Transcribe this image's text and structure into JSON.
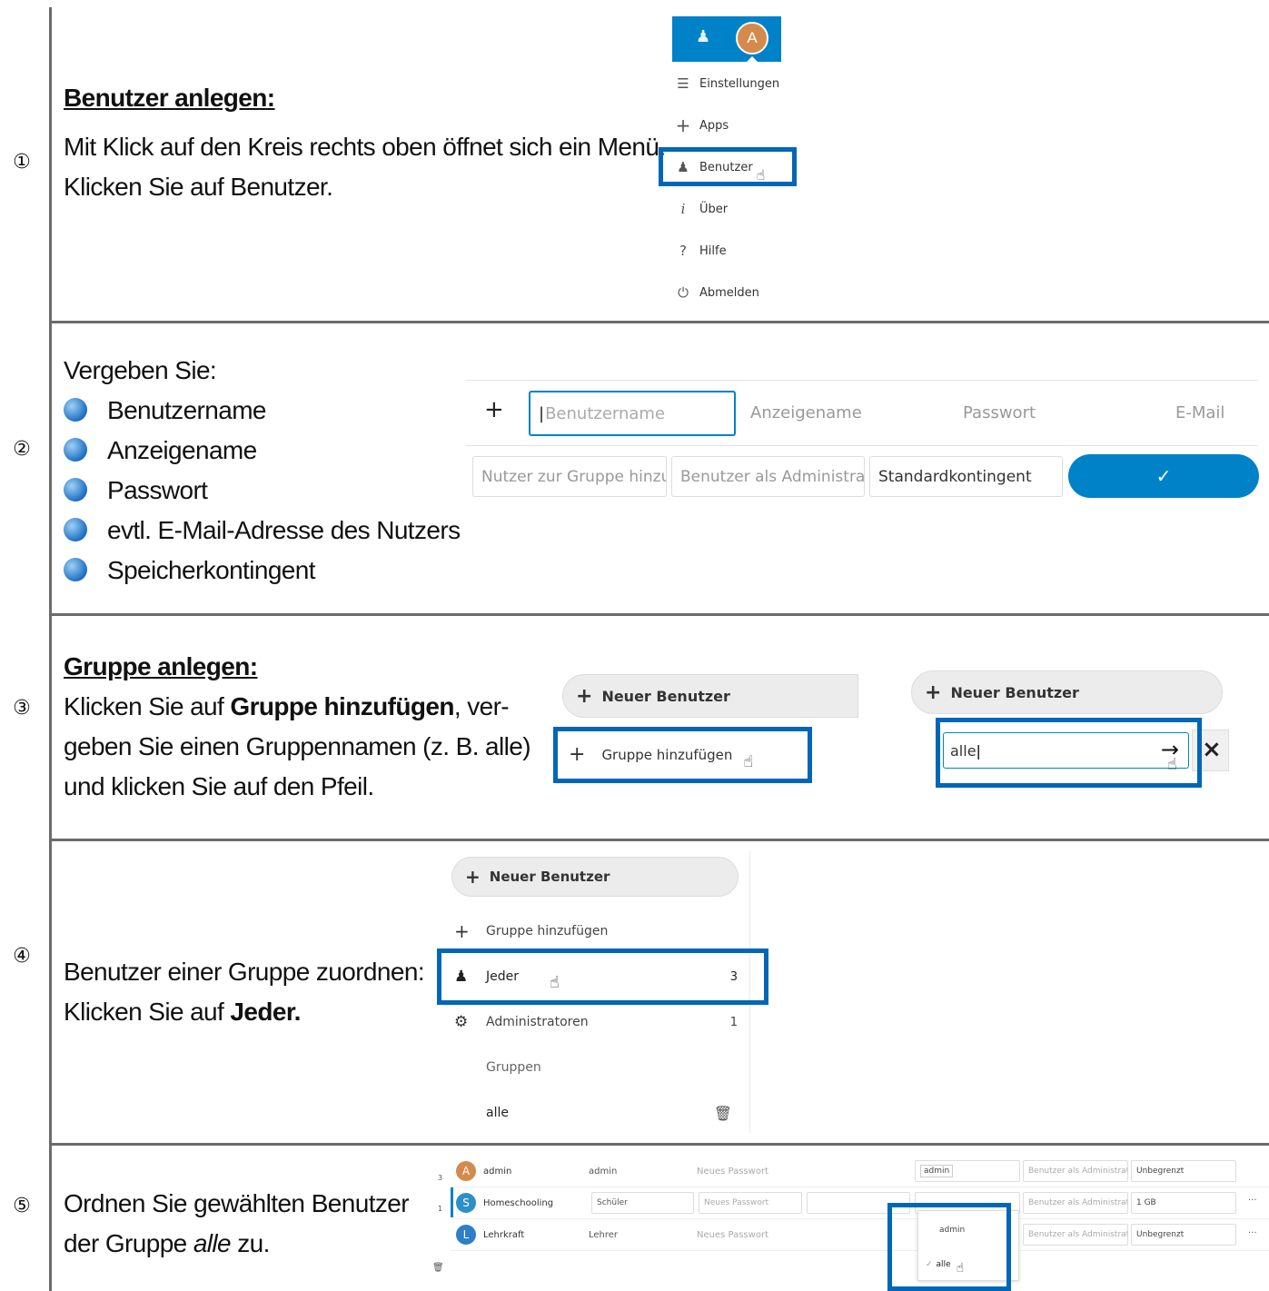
{
  "steps": [
    {
      "num": "①",
      "heading": "Benutzer anlegen:",
      "lines": [
        "Mit Klick auf den Kreis rechts oben öffnet sich ein Menü.",
        "Klicken Sie auf Benutzer."
      ]
    },
    {
      "num": "②",
      "intro": "Vergeben Sie:",
      "bullets": [
        "Benutzername",
        "Anzeigename",
        "Passwort",
        "evtl. E-Mail-Adresse des Nutzers",
        "Speicherkontingent"
      ]
    },
    {
      "num": "③",
      "heading": "Gruppe anlegen:",
      "line1_pre": "Klicken Sie auf ",
      "line1_bold": "Gruppe hinzufügen",
      "line1_post": ", ver-",
      "line2": "geben Sie einen Gruppennamen (z. B. alle)",
      "line3": "und klicken Sie auf den Pfeil."
    },
    {
      "num": "④",
      "line1": "Benutzer einer Gruppe zuordnen:",
      "line2_pre": "Klicken Sie auf ",
      "line2_bold": "Jeder."
    },
    {
      "num": "⑤",
      "line1": "Ordnen Sie gewählten Benutzer",
      "line2_pre": "der Gruppe ",
      "line2_em": "alle",
      "line2_post": " zu."
    }
  ],
  "menu": {
    "avatar_letter": "A",
    "items": [
      "Einstellungen",
      "Apps",
      "Benutzer",
      "Über",
      "Hilfe",
      "Abmelden"
    ]
  },
  "new_user_form": {
    "plus": "+",
    "fields": [
      "Benutzername",
      "Anzeigename",
      "Passwort",
      "E-Mail"
    ],
    "group_placeholder": "Nutzer zur Gruppe hinzu",
    "admin_placeholder": "Benutzer als Administrat",
    "quota": "Standardkontingent",
    "confirm": "✓"
  },
  "group_create": {
    "new_user": "Neuer Benutzer",
    "add_group": "Gruppe hinzufügen",
    "group_input_value": "alle",
    "arrow": "→",
    "close": "×"
  },
  "group_list": {
    "new_user": "Neuer Benutzer",
    "add_group": "Gruppe hinzufügen",
    "items": [
      {
        "label": "Jeder",
        "count": "3"
      },
      {
        "label": "Administratoren",
        "count": "1"
      }
    ],
    "section": "Gruppen",
    "custom": "alle"
  },
  "user_table": {
    "side_counts": [
      "3",
      "1"
    ],
    "rows": [
      {
        "letter": "A",
        "color": "#d48a4d",
        "name": "admin",
        "display": "admin",
        "password": "Neues Passwort",
        "group": "admin",
        "admin": "Benutzer als Administrat",
        "quota": "Unbegrenzt"
      },
      {
        "letter": "S",
        "color": "#2d8fc7",
        "name": "Homeschooling",
        "display": "Schüler",
        "password": "Neues Passwort",
        "group": "",
        "admin": "Benutzer als Administrat",
        "quota": "1 GB",
        "more": "···"
      },
      {
        "letter": "L",
        "color": "#2d7fc7",
        "name": "Lehrkraft",
        "display": "Lehrer",
        "password": "Neues Passwort",
        "group": "",
        "admin": "Benutzer als Administrat",
        "quota": "Unbegrenzt",
        "more": "···"
      }
    ],
    "dropdown": [
      "admin",
      "alle"
    ],
    "dropdown_check": "✓"
  },
  "colors": {
    "accent": "#0066b8",
    "button": "#0082c9",
    "rule": "#6b6b6b"
  }
}
